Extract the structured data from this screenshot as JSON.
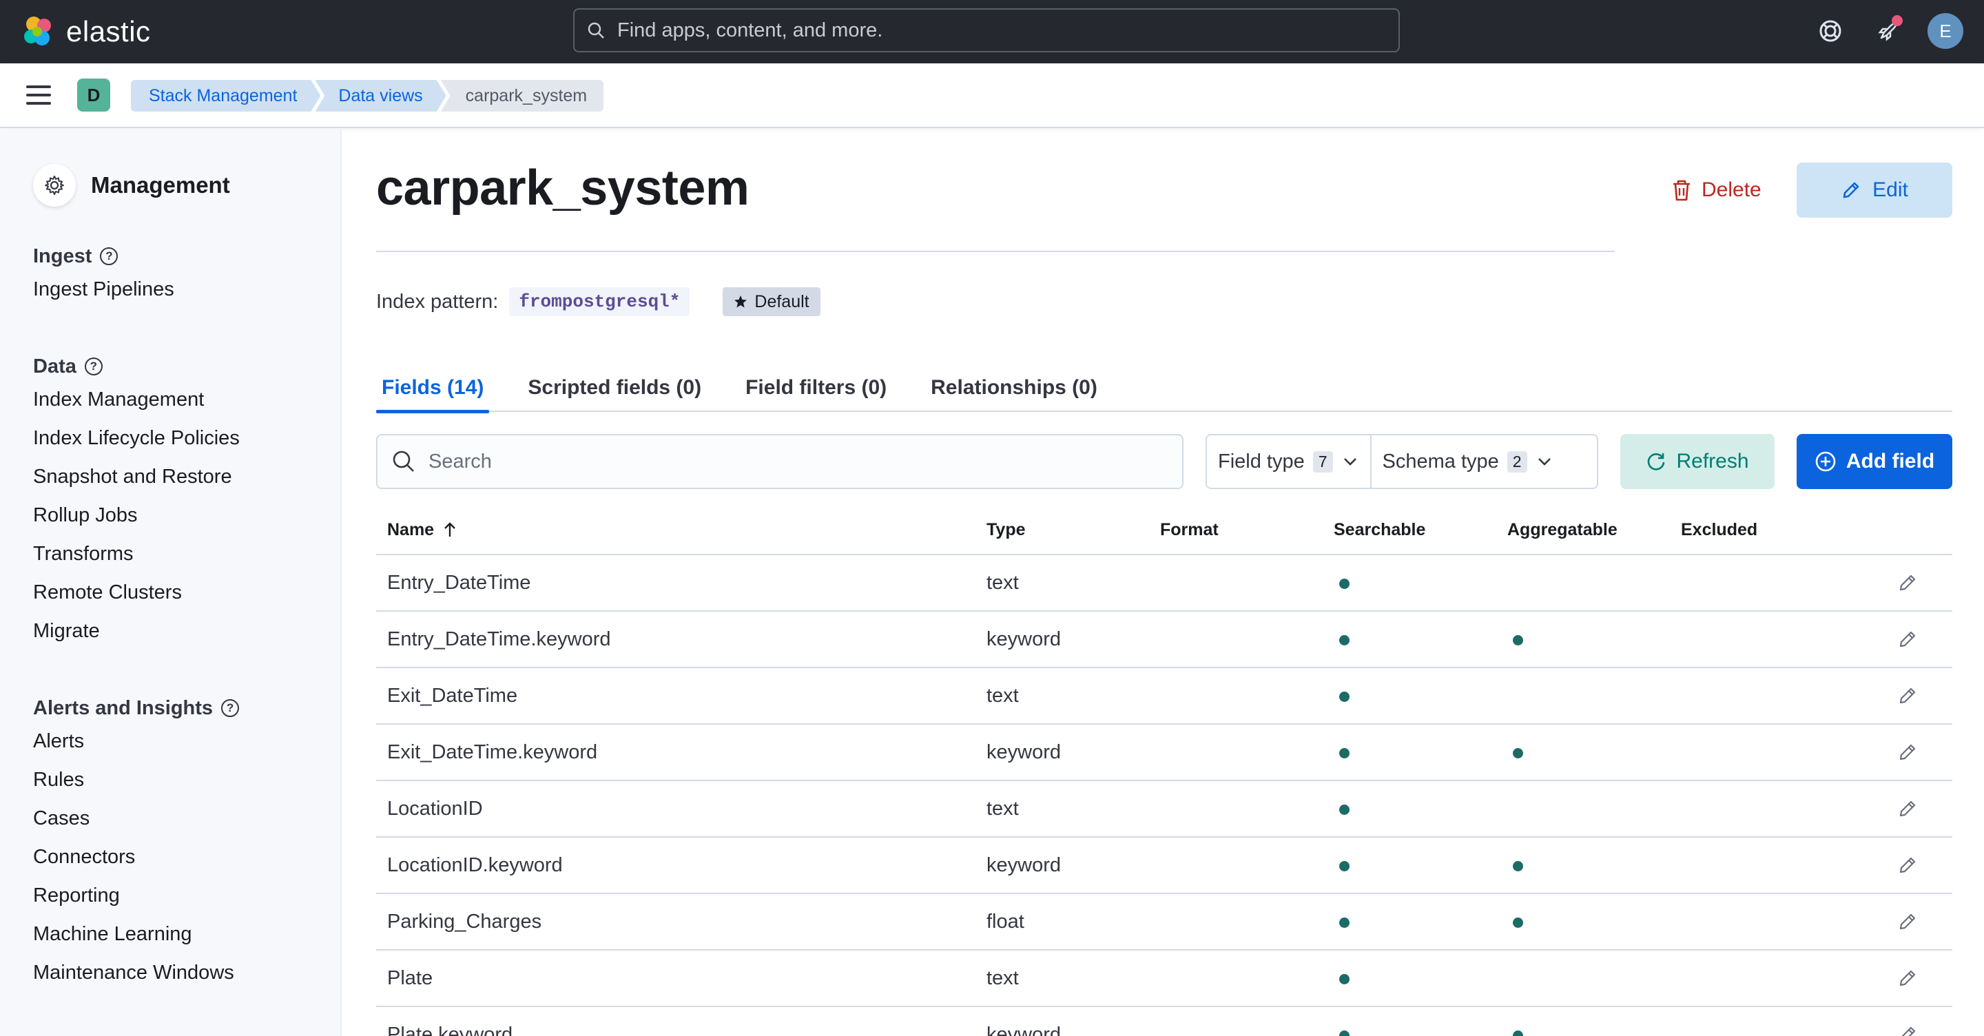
{
  "header": {
    "brand": "elastic",
    "search_placeholder": "Find apps, content, and more.",
    "user_initial": "E"
  },
  "breadcrumbs": {
    "space_initial": "D",
    "items": [
      "Stack Management",
      "Data views",
      "carpark_system"
    ]
  },
  "sidebar": {
    "title": "Management",
    "groups": [
      {
        "title": "Ingest",
        "items": [
          "Ingest Pipelines"
        ]
      },
      {
        "title": "Data",
        "items": [
          "Index Management",
          "Index Lifecycle Policies",
          "Snapshot and Restore",
          "Rollup Jobs",
          "Transforms",
          "Remote Clusters",
          "Migrate"
        ]
      },
      {
        "title": "Alerts and Insights",
        "items": [
          "Alerts",
          "Rules",
          "Cases",
          "Connectors",
          "Reporting",
          "Machine Learning",
          "Maintenance Windows"
        ]
      }
    ]
  },
  "page": {
    "title": "carpark_system",
    "delete_label": "Delete",
    "edit_label": "Edit",
    "index_pattern_label": "Index pattern:",
    "index_pattern": "frompostgresql*",
    "default_badge": "Default"
  },
  "tabs": [
    {
      "label": "Fields (14)",
      "active": true
    },
    {
      "label": "Scripted fields (0)",
      "active": false
    },
    {
      "label": "Field filters (0)",
      "active": false
    },
    {
      "label": "Relationships (0)",
      "active": false
    }
  ],
  "toolbar": {
    "search_placeholder": "Search",
    "field_type_label": "Field type",
    "field_type_count": "7",
    "schema_type_label": "Schema type",
    "schema_type_count": "2",
    "refresh_label": "Refresh",
    "add_field_label": "Add field"
  },
  "table": {
    "columns": [
      "Name",
      "Type",
      "Format",
      "Searchable",
      "Aggregatable",
      "Excluded"
    ],
    "rows": [
      {
        "name": "Entry_DateTime",
        "type": "text",
        "format": "",
        "searchable": true,
        "aggregatable": false,
        "excluded": false
      },
      {
        "name": "Entry_DateTime.keyword",
        "type": "keyword",
        "format": "",
        "searchable": true,
        "aggregatable": true,
        "excluded": false
      },
      {
        "name": "Exit_DateTime",
        "type": "text",
        "format": "",
        "searchable": true,
        "aggregatable": false,
        "excluded": false
      },
      {
        "name": "Exit_DateTime.keyword",
        "type": "keyword",
        "format": "",
        "searchable": true,
        "aggregatable": true,
        "excluded": false
      },
      {
        "name": "LocationID",
        "type": "text",
        "format": "",
        "searchable": true,
        "aggregatable": false,
        "excluded": false
      },
      {
        "name": "LocationID.keyword",
        "type": "keyword",
        "format": "",
        "searchable": true,
        "aggregatable": true,
        "excluded": false
      },
      {
        "name": "Parking_Charges",
        "type": "float",
        "format": "",
        "searchable": true,
        "aggregatable": true,
        "excluded": false
      },
      {
        "name": "Plate",
        "type": "text",
        "format": "",
        "searchable": true,
        "aggregatable": false,
        "excluded": false
      },
      {
        "name": "Plate.keyword",
        "type": "keyword",
        "format": "",
        "searchable": true,
        "aggregatable": true,
        "excluded": false
      }
    ]
  },
  "colors": {
    "header_bg": "#25282f",
    "primary": "#0b64dd",
    "danger": "#bd271e",
    "success": "#017d73",
    "dot": "#1c6b66"
  }
}
